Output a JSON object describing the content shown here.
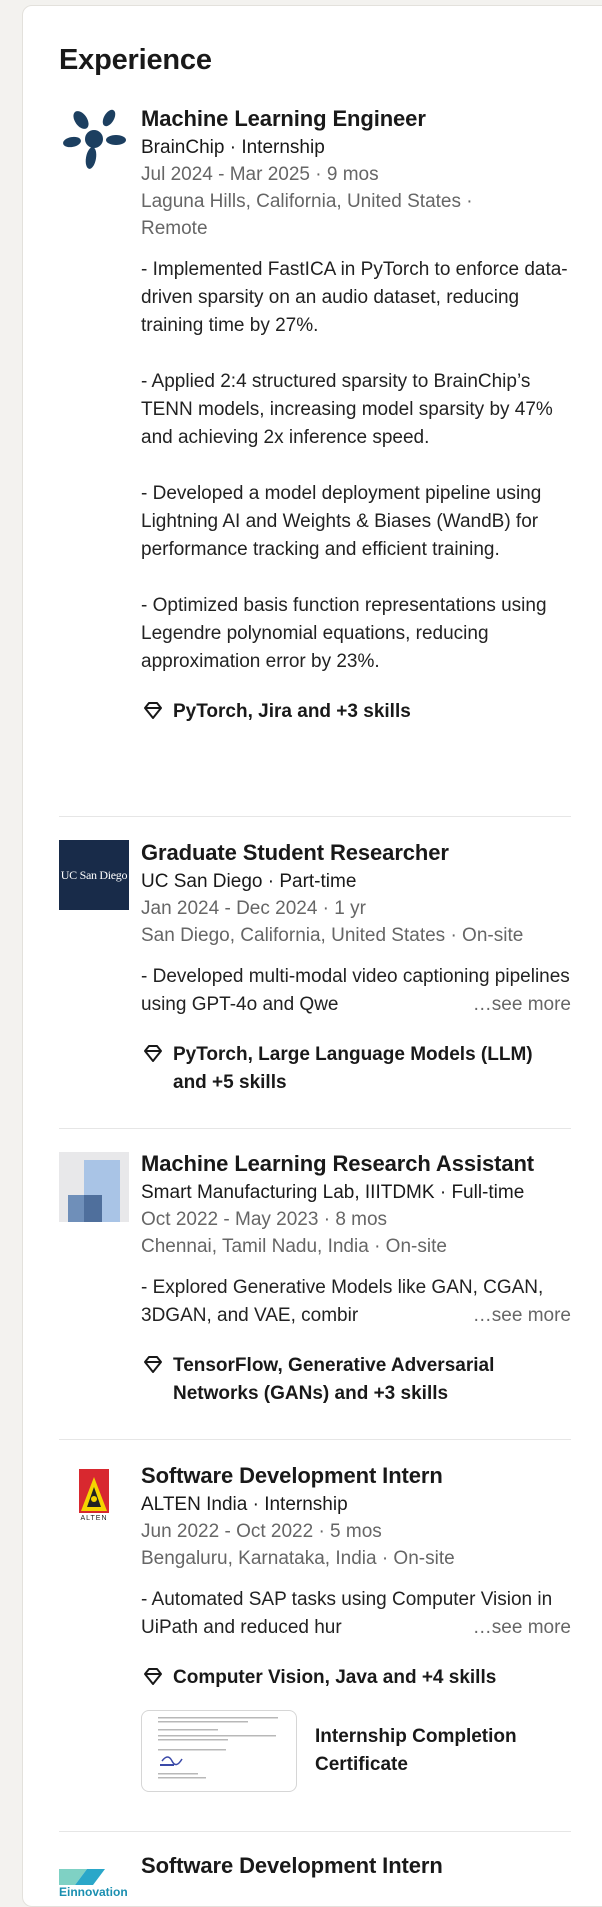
{
  "section_title": "Experience",
  "entries": [
    {
      "logo_icon": "brainchip-logo",
      "title": "Machine Learning Engineer",
      "company_line": "BrainChip · Internship",
      "dates": "Jul 2024 - Mar 2025 · 9 mos",
      "location_1": "Laguna Hills, California, United States ·",
      "location_2": "Remote",
      "desc": [
        "- Implemented FastICA in PyTorch to enforce data-driven sparsity on an audio dataset, reducing training time by 27%.",
        "- Applied 2:4 structured sparsity to BrainChip’s TENN models, increasing model sparsity by 47% and achieving 2x inference speed.",
        "- Developed a model deployment pipeline using Lightning AI and Weights & Biases (WandB) for performance tracking and efficient training.",
        "- Optimized basis function representations using Legendre polynomial equations, reducing approximation error by 23%."
      ],
      "skills": "PyTorch, Jira and +3 skills"
    },
    {
      "logo_text": "UC San Diego",
      "title": "Graduate Student Researcher",
      "company_line": "UC San Diego · Part-time",
      "dates": "Jan 2024 - Dec 2024 · 1 yr",
      "location": "San Diego, California, United States · On-site",
      "desc_truncated": "- Developed multi-modal video captioning pipelines using GPT-4o and Qwe",
      "see_more": "…see more",
      "skills": "PyTorch, Large Language Models (LLM) and +5 skills"
    },
    {
      "logo_icon": "smart-manufacturing-lab-logo",
      "title": "Machine Learning Research Assistant",
      "company_line": "Smart Manufacturing Lab, IIITDMK · Full-time",
      "dates": "Oct 2022 - May 2023 · 8 mos",
      "location": "Chennai, Tamil Nadu, India · On-site",
      "desc_truncated": "- Explored Generative Models like GAN, CGAN, 3DGAN, and VAE, combir",
      "see_more": "…see more",
      "skills": "TensorFlow, Generative Adversarial Networks (GANs) and +3 skills"
    },
    {
      "logo_text": "ALTEN",
      "title": "Software Development Intern",
      "company_line": "ALTEN India · Internship",
      "dates": "Jun 2022 - Oct 2022 · 5 mos",
      "location": "Bengaluru, Karnataka, India · On-site",
      "desc_truncated": "- Automated SAP tasks using Computer Vision in UiPath and reduced hur",
      "see_more": "…see more",
      "skills": "Computer Vision, Java and +4 skills",
      "certificate_title": "Internship Completion Certificate"
    },
    {
      "logo_text": "Einnovation",
      "title": "Software Development Intern"
    }
  ],
  "colors": {
    "brainchip": "#1c3f60",
    "ucsd_bg": "#182b49",
    "muted": "#666666",
    "alten_red": "#d8282f",
    "alten_yellow": "#f5d400"
  }
}
